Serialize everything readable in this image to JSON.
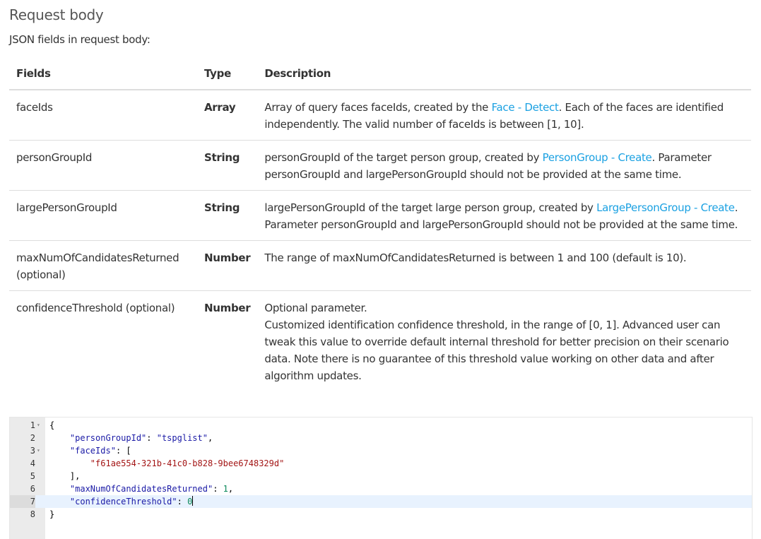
{
  "section": {
    "title": "Request body",
    "intro": "JSON fields in request body:"
  },
  "table": {
    "headers": [
      "Fields",
      "Type",
      "Description"
    ],
    "rows": [
      {
        "field": "faceIds",
        "type": "Array",
        "desc_before": "Array of query faces faceIds, created by the ",
        "link": "Face - Detect",
        "desc_after": ". Each of the faces are identified independently. The valid number of faceIds is between [1, 10]."
      },
      {
        "field": "personGroupId",
        "type": "String",
        "desc_before": "personGroupId of the target person group, created by ",
        "link": "PersonGroup - Create",
        "desc_after": ". Parameter personGroupId and largePersonGroupId should not be provided at the same time."
      },
      {
        "field": "largePersonGroupId",
        "type": "String",
        "desc_before": "largePersonGroupId of the target large person group, created by ",
        "link": "LargePersonGroup - Create",
        "desc_after": ". Parameter personGroupId and largePersonGroupId should not be provided at the same time."
      },
      {
        "field": "maxNumOfCandidatesReturned (optional)",
        "type": "Number",
        "desc": "The range of maxNumOfCandidatesReturned is between 1 and 100 (default is 10)."
      },
      {
        "field": "confidenceThreshold (optional)",
        "type": "Number",
        "desc_line1": "Optional parameter.",
        "desc_line2": "Customized identification confidence threshold, in the range of [0, 1]. Advanced user can tweak this value to override default internal threshold for better precision on their scenario data. Note there is no guarantee of this threshold value working on other data and after algorithm updates."
      }
    ]
  },
  "editor": {
    "line_numbers": [
      "1",
      "2",
      "3",
      "4",
      "5",
      "6",
      "7",
      "8"
    ],
    "fold_marker": "▾",
    "lines": {
      "l1": "{",
      "l2_key": "\"personGroupId\"",
      "l2_sep": ": ",
      "l2_val": "\"tspglist\"",
      "l2_end": ",",
      "l3_key": "\"faceIds\"",
      "l3_rest": ": [",
      "l4_val": "\"f61ae554-321b-41c0-b828-9bee6748329d\"",
      "l5": "],",
      "l6_key": "\"maxNumOfCandidatesReturned\"",
      "l6_sep": ": ",
      "l6_val": "1",
      "l6_end": ",",
      "l7_key": "\"confidenceThreshold\"",
      "l7_sep": ": ",
      "l7_val": "0",
      "l8": "}"
    }
  }
}
